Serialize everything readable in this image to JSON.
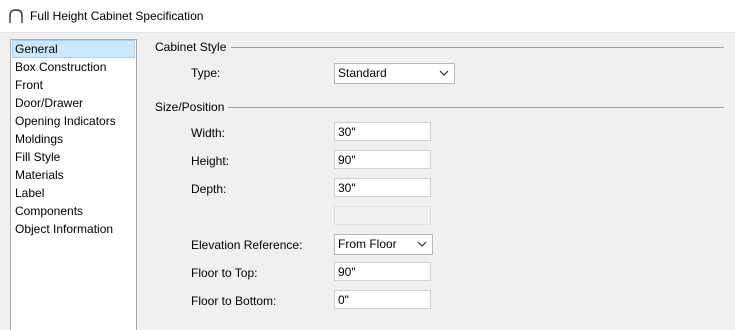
{
  "window": {
    "title": "Full Height Cabinet Specification"
  },
  "nav": {
    "items": [
      {
        "label": "General",
        "selected": true
      },
      {
        "label": "Box Construction"
      },
      {
        "label": "Front"
      },
      {
        "label": "Door/Drawer"
      },
      {
        "label": "Opening Indicators"
      },
      {
        "label": "Moldings"
      },
      {
        "label": "Fill Style"
      },
      {
        "label": "Materials"
      },
      {
        "label": "Label"
      },
      {
        "label": "Components"
      },
      {
        "label": "Object Information"
      }
    ]
  },
  "cabinet_style": {
    "title": "Cabinet Style",
    "type_label": "Type:",
    "type_value": "Standard"
  },
  "size_position": {
    "title": "Size/Position",
    "width_label": "Width:",
    "width_value": "30\"",
    "height_label": "Height:",
    "height_value": "90\"",
    "depth_label": "Depth:",
    "depth_value": "30\"",
    "elevation_label": "Elevation Reference:",
    "elevation_value": "From Floor",
    "floor_top_label": "Floor to Top:",
    "floor_top_value": "90\"",
    "floor_bottom_label": "Floor to Bottom:",
    "floor_bottom_value": "0\""
  }
}
